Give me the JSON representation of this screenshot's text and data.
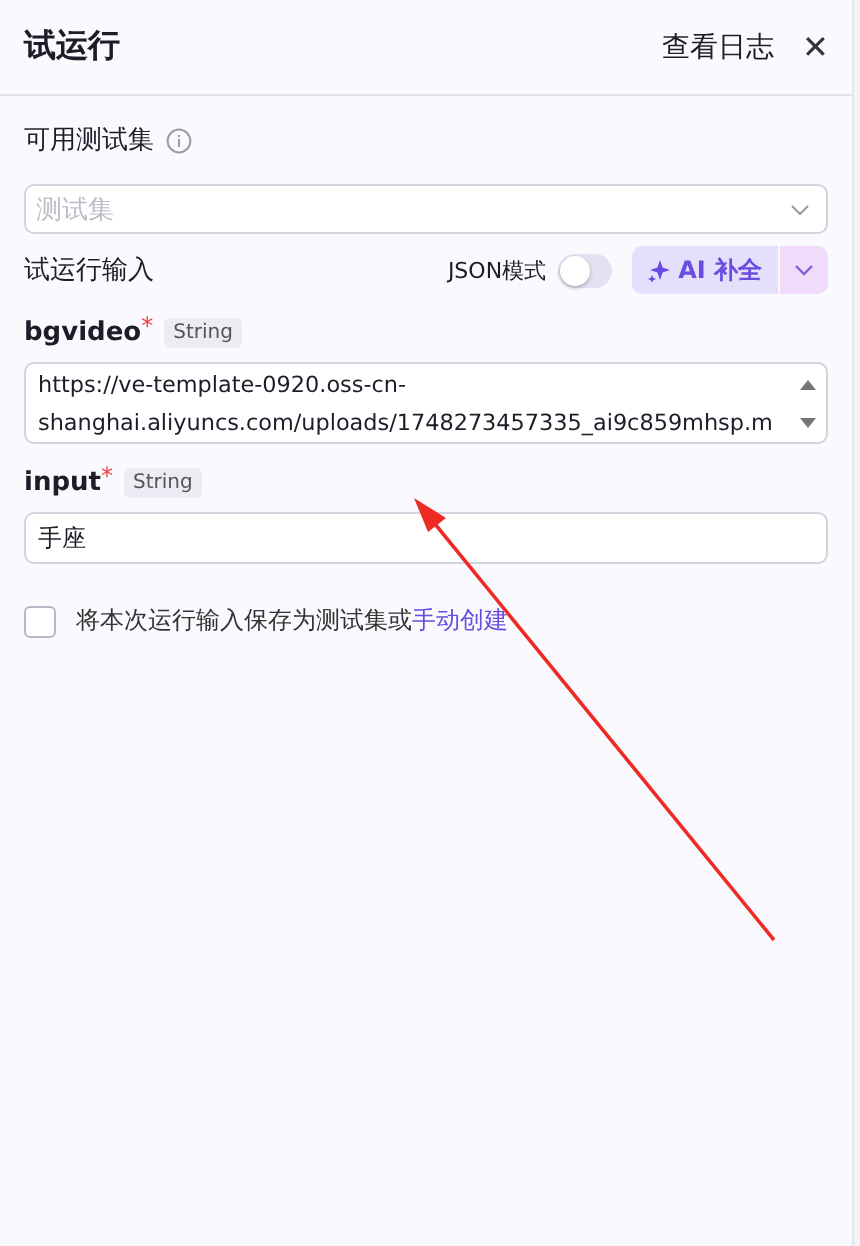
{
  "header": {
    "title": "试运行",
    "log_link": "查看日志",
    "close": "✕"
  },
  "test_set": {
    "label": "可用测试集",
    "placeholder": "测试集"
  },
  "run_input": {
    "label": "试运行输入",
    "json_mode": {
      "label": "JSON模式",
      "on": false
    },
    "ai_button": "AI 补全"
  },
  "fields": [
    {
      "name": "bgvideo",
      "required_mark": "*",
      "type": "String",
      "kind": "textarea",
      "value": "https://ve-template-0920.oss-cn-shanghai.aliyuncs.com/uploads/1748273457335_ai9c859mhsp.m"
    },
    {
      "name": "input",
      "required_mark": "*",
      "type": "String",
      "kind": "text",
      "value": "手座"
    }
  ],
  "save_option": {
    "checked": false,
    "text": "将本次运行输入保存为测试集或",
    "link": "手动创建"
  },
  "annotations": [
    {
      "kind": "arrow",
      "color": "#ee2a24"
    }
  ]
}
